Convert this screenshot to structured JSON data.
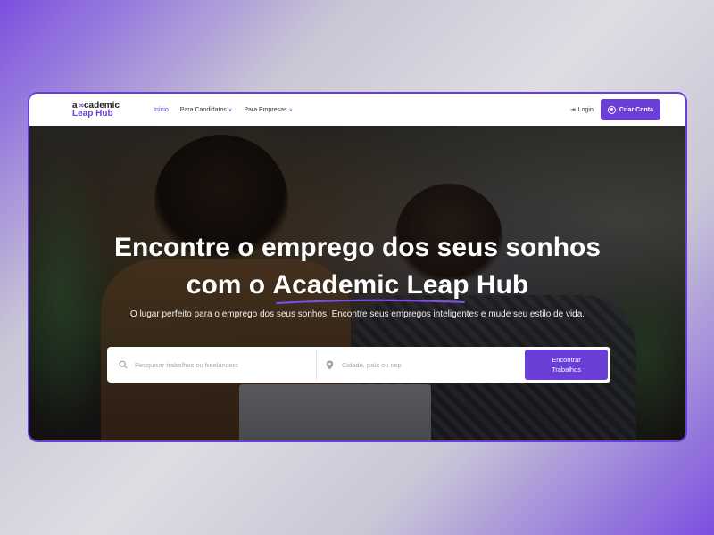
{
  "brand": {
    "logo_top_prefix": "a",
    "logo_top_suffix": "cademic",
    "logo_bottom": "Leap Hub",
    "accent": "#6a3fd8"
  },
  "nav": {
    "items": [
      {
        "label": "Início",
        "has_dropdown": false
      },
      {
        "label": "Para Candidatos",
        "has_dropdown": true
      },
      {
        "label": "Para Empresas",
        "has_dropdown": true
      }
    ],
    "login_label": "Login",
    "signup_label": "Criar Conta",
    "icons": {
      "login": "login-icon",
      "signup": "user-circle-icon",
      "dropdown": "chevron-down-icon"
    }
  },
  "hero": {
    "title_line1": "Encontre o emprego dos seus sonhos",
    "title_line2_prefix": "com o ",
    "title_line2_highlight": "Academic Leap",
    "title_line2_suffix": " Hub",
    "subtitle": "O lugar perfeito para o emprego dos seus sonhos. Encontre seus empregos inteligentes e mude seu estilo de vida."
  },
  "search": {
    "job_placeholder": "Pesquisar trabalhos ou freelancers",
    "location_placeholder": "Cidade, país ou cep",
    "button_label": "Encontrar Trabalhos",
    "icons": {
      "job": "search-icon",
      "location": "map-pin-icon"
    }
  }
}
